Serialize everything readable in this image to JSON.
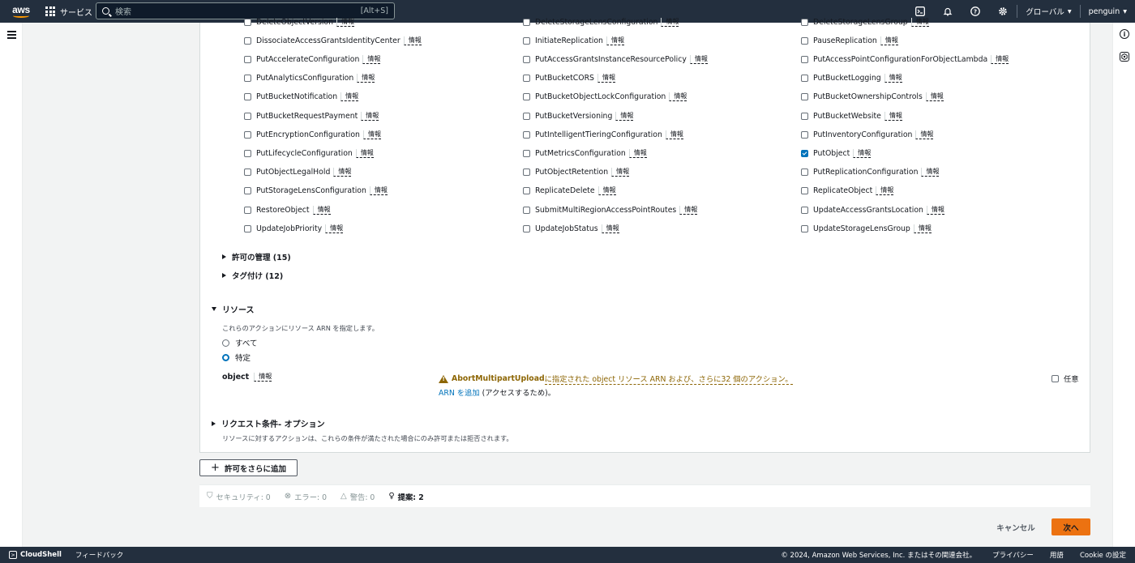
{
  "topnav": {
    "logo": "aws",
    "services": "サービス",
    "search_placeholder": "検索",
    "search_shortcut": "[Alt+S]",
    "region": "グローバル",
    "user": "penguin",
    "icons": [
      "cloudshell-icon",
      "bell-icon",
      "help-icon",
      "gear-icon"
    ]
  },
  "info_label": "情報",
  "actions": {
    "col1": [
      {
        "name": "DeleteObjectVersion",
        "checked": false
      },
      {
        "name": "DissociateAccessGrantsIdentityCenter",
        "checked": false
      },
      {
        "name": "PutAccelerateConfiguration",
        "checked": false
      },
      {
        "name": "PutAnalyticsConfiguration",
        "checked": false
      },
      {
        "name": "PutBucketNotification",
        "checked": false
      },
      {
        "name": "PutBucketRequestPayment",
        "checked": false
      },
      {
        "name": "PutEncryptionConfiguration",
        "checked": false
      },
      {
        "name": "PutLifecycleConfiguration",
        "checked": false
      },
      {
        "name": "PutObjectLegalHold",
        "checked": false
      },
      {
        "name": "PutStorageLensConfiguration",
        "checked": false
      },
      {
        "name": "RestoreObject",
        "checked": false
      },
      {
        "name": "UpdateJobPriority",
        "checked": false
      }
    ],
    "col2": [
      {
        "name": "DeleteStorageLensConfiguration",
        "checked": false
      },
      {
        "name": "InitiateReplication",
        "checked": false
      },
      {
        "name": "PutAccessGrantsInstanceResourcePolicy",
        "checked": false
      },
      {
        "name": "PutBucketCORS",
        "checked": false
      },
      {
        "name": "PutBucketObjectLockConfiguration",
        "checked": false
      },
      {
        "name": "PutBucketVersioning",
        "checked": false
      },
      {
        "name": "PutIntelligentTieringConfiguration",
        "checked": false
      },
      {
        "name": "PutMetricsConfiguration",
        "checked": false
      },
      {
        "name": "PutObjectRetention",
        "checked": false
      },
      {
        "name": "ReplicateDelete",
        "checked": false
      },
      {
        "name": "SubmitMultiRegionAccessPointRoutes",
        "checked": false
      },
      {
        "name": "UpdateJobStatus",
        "checked": false
      }
    ],
    "col3": [
      {
        "name": "DeleteStorageLensGroup",
        "checked": false
      },
      {
        "name": "PauseReplication",
        "checked": false
      },
      {
        "name": "PutAccessPointConfigurationForObjectLambda",
        "checked": false
      },
      {
        "name": "PutBucketLogging",
        "checked": false
      },
      {
        "name": "PutBucketOwnershipControls",
        "checked": false
      },
      {
        "name": "PutBucketWebsite",
        "checked": false
      },
      {
        "name": "PutInventoryConfiguration",
        "checked": false
      },
      {
        "name": "PutObject",
        "checked": true
      },
      {
        "name": "PutReplicationConfiguration",
        "checked": false
      },
      {
        "name": "ReplicateObject",
        "checked": false
      },
      {
        "name": "UpdateAccessGrantsLocation",
        "checked": false
      },
      {
        "name": "UpdateStorageLensGroup",
        "checked": false
      }
    ]
  },
  "groups": {
    "permissions": "許可の管理 (15)",
    "tagging": "タグ付け (12)"
  },
  "resources": {
    "heading": "リソース",
    "description": "これらのアクションにリソース ARN を指定します。",
    "radio_all": "すべて",
    "radio_specific": "特定",
    "resource_type": "object",
    "warning_action": "AbortMultipartUpload",
    "warning_mid": " に指定された object リソース ARN および、さらに ",
    "warning_link": "32 個のアクション。",
    "arn_link": "ARN を追加",
    "arn_suffix": " (アクセスするため)。",
    "any_label": "任意"
  },
  "conditions": {
    "heading": "リクエスト条件",
    "heading_suffix": " - オプション",
    "description": "リソースに対するアクションは、これらの条件が満たされた場合にのみ許可または拒否されます。"
  },
  "add_permission_button": "許可をさらに追加",
  "status": {
    "security": "セキュリティ: 0",
    "errors": "エラー: 0",
    "warnings": "警告: 0",
    "suggestions": "提案: 2"
  },
  "buttons": {
    "cancel": "キャンセル",
    "next": "次へ"
  },
  "footer": {
    "cloudshell": "CloudShell",
    "feedback": "フィードバック",
    "copyright": "© 2024, Amazon Web Services, Inc. またはその関連会社。",
    "privacy": "プライバシー",
    "terms": "用語",
    "cookie": "Cookie の設定"
  },
  "colors": {
    "nav_bg": "#232f3e",
    "accent": "#ec7211",
    "link": "#0073bb",
    "warning": "#8d6605"
  }
}
